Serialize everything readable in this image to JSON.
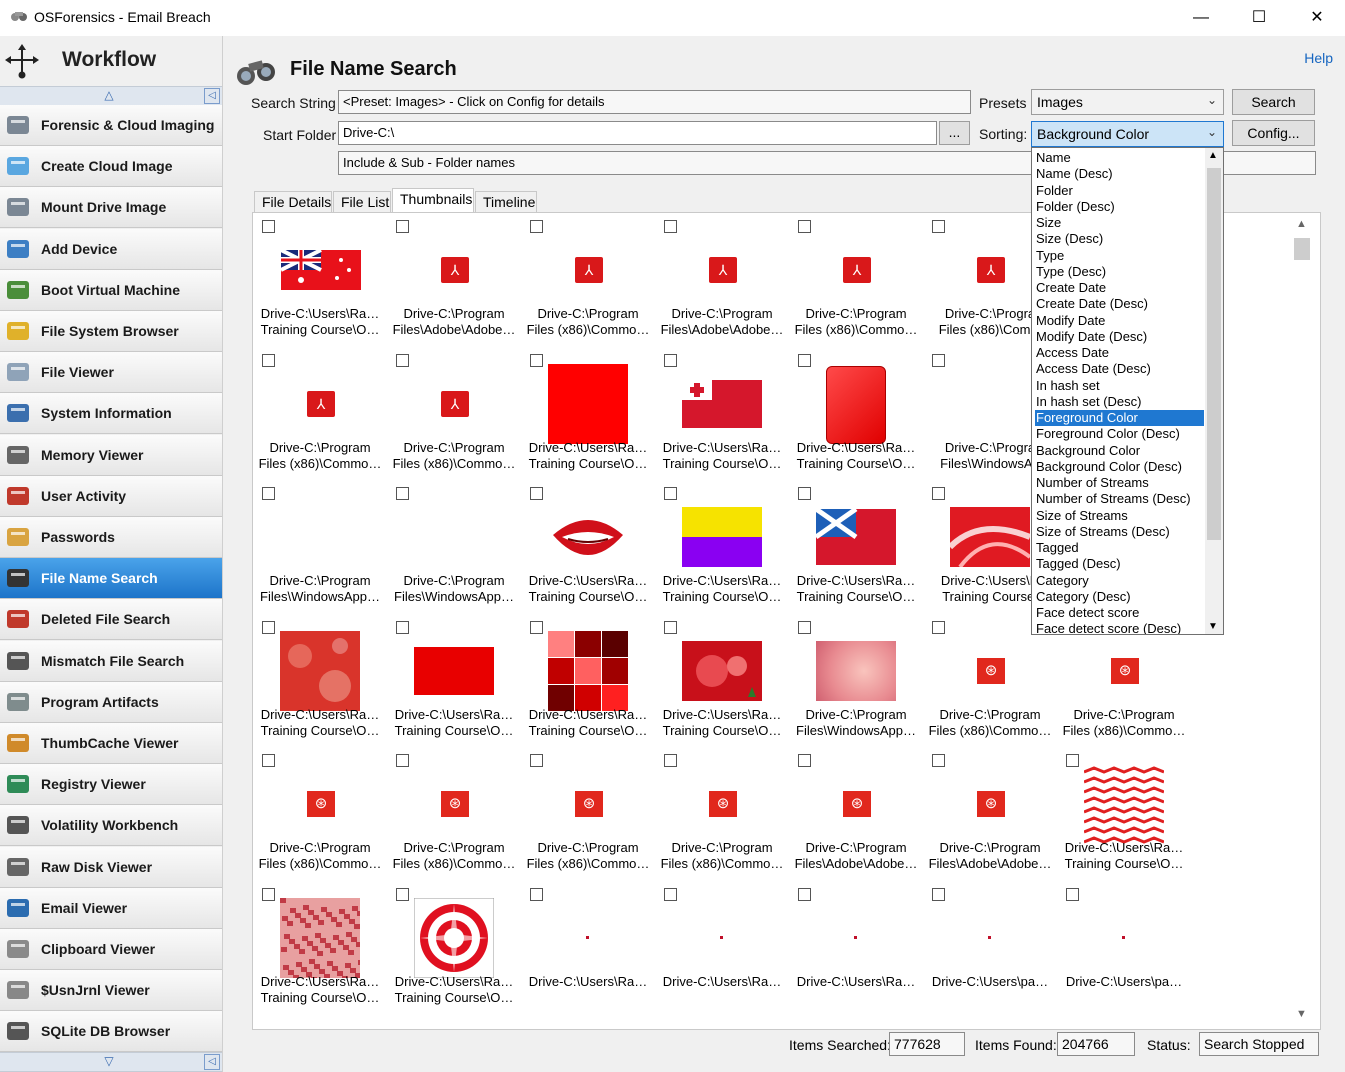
{
  "window": {
    "title": "OSForensics - Email Breach",
    "minimize": "—",
    "maximize": "☐",
    "close": "✕"
  },
  "sidebar": {
    "title": "Workflow",
    "items": [
      {
        "label": "Forensic & Cloud Imaging",
        "icon": "disk-icon"
      },
      {
        "label": "Create Cloud Image",
        "icon": "cloud-icon"
      },
      {
        "label": "Mount Drive Image",
        "icon": "drive-icon"
      },
      {
        "label": "Add Device",
        "icon": "add-device-icon"
      },
      {
        "label": "Boot Virtual Machine",
        "icon": "vm-icon"
      },
      {
        "label": "File System Browser",
        "icon": "folder-icon"
      },
      {
        "label": "File Viewer",
        "icon": "file-viewer-icon"
      },
      {
        "label": "System Information",
        "icon": "system-info-icon"
      },
      {
        "label": "Memory Viewer",
        "icon": "memory-icon"
      },
      {
        "label": "User Activity",
        "icon": "user-activity-icon"
      },
      {
        "label": "Passwords",
        "icon": "passwords-icon"
      },
      {
        "label": "File Name Search",
        "icon": "binoculars-icon"
      },
      {
        "label": "Deleted File Search",
        "icon": "deleted-file-icon"
      },
      {
        "label": "Mismatch File Search",
        "icon": "mismatch-icon"
      },
      {
        "label": "Program Artifacts",
        "icon": "artifacts-icon"
      },
      {
        "label": "ThumbCache Viewer",
        "icon": "thumbcache-icon"
      },
      {
        "label": "Registry Viewer",
        "icon": "registry-icon"
      },
      {
        "label": "Volatility Workbench",
        "icon": "volatility-icon"
      },
      {
        "label": "Raw Disk Viewer",
        "icon": "raw-disk-icon"
      },
      {
        "label": "Email Viewer",
        "icon": "email-icon"
      },
      {
        "label": "Clipboard Viewer",
        "icon": "clipboard-icon"
      },
      {
        "label": "$UsnJrnl Viewer",
        "icon": "usnjrnl-icon"
      },
      {
        "label": "SQLite DB Browser",
        "icon": "sqlite-icon"
      }
    ]
  },
  "header": {
    "title": "File Name Search",
    "help": "Help"
  },
  "form": {
    "search_label": "Search String",
    "search_value": "<Preset: Images> - Click on Config for details",
    "folder_label": "Start Folder",
    "folder_value": "Drive-C:\\",
    "browse_label": "...",
    "scope_value": "Include & Sub - Folder names",
    "presets_label": "Presets",
    "presets_value": "Images",
    "sorting_label": "Sorting:",
    "sorting_value": "Background Color",
    "search_button": "Search",
    "config_button": "Config..."
  },
  "tabs": [
    "File Details",
    "File List",
    "Thumbnails",
    "Timeline"
  ],
  "sort_options": [
    "Name",
    "Name (Desc)",
    "Folder",
    "Folder (Desc)",
    "Size",
    "Size (Desc)",
    "Type",
    "Type (Desc)",
    "Create Date",
    "Create Date (Desc)",
    "Modify Date",
    "Modify Date (Desc)",
    "Access Date",
    "Access Date (Desc)",
    "In hash set",
    "In hash set (Desc)",
    "Foreground Color",
    "Foreground Color (Desc)",
    "Background Color",
    "Background Color (Desc)",
    "Number of Streams",
    "Number of Streams (Desc)",
    "Size of Streams",
    "Size of Streams (Desc)",
    "Tagged",
    "Tagged (Desc)",
    "Category",
    "Category (Desc)",
    "Face detect score",
    "Face detect score (Desc)"
  ],
  "thumbnails": [
    [
      {
        "kind": "flag-au",
        "l1": "Drive-C:\\Users\\Ra…",
        "l2": "Training Course\\O…"
      },
      {
        "kind": "pdf",
        "l1": "Drive-C:\\Program",
        "l2": "Files\\Adobe\\Adobe…"
      },
      {
        "kind": "pdf",
        "l1": "Drive-C:\\Program",
        "l2": "Files (x86)\\Commo…"
      },
      {
        "kind": "pdf",
        "l1": "Drive-C:\\Program",
        "l2": "Files\\Adobe\\Adobe…"
      },
      {
        "kind": "pdf",
        "l1": "Drive-C:\\Program",
        "l2": "Files (x86)\\Commo…"
      },
      {
        "kind": "pdf",
        "l1": "Drive-C:\\Progra",
        "l2": "Files (x86)\\Comm"
      }
    ],
    [
      {
        "kind": "pdf",
        "l1": "Drive-C:\\Program",
        "l2": "Files (x86)\\Commo…"
      },
      {
        "kind": "pdf",
        "l1": "Drive-C:\\Program",
        "l2": "Files (x86)\\Commo…"
      },
      {
        "kind": "red-square",
        "l1": "Drive-C:\\Users\\Ra…",
        "l2": "Training Course\\O…"
      },
      {
        "kind": "flag-tonga",
        "l1": "Drive-C:\\Users\\Ra…",
        "l2": "Training Course\\O…"
      },
      {
        "kind": "red-rounded",
        "l1": "Drive-C:\\Users\\Ra…",
        "l2": "Training Course\\O…"
      },
      {
        "kind": "none",
        "l1": "Drive-C:\\Progra",
        "l2": "Files\\WindowsAp"
      }
    ],
    [
      {
        "kind": "none",
        "l1": "Drive-C:\\Program",
        "l2": "Files\\WindowsApp…"
      },
      {
        "kind": "none",
        "l1": "Drive-C:\\Program",
        "l2": "Files\\WindowsApp…"
      },
      {
        "kind": "lips",
        "l1": "Drive-C:\\Users\\Ra…",
        "l2": "Training Course\\O…"
      },
      {
        "kind": "yellow-purple",
        "l1": "Drive-C:\\Users\\Ra…",
        "l2": "Training Course\\O…"
      },
      {
        "kind": "flag-scot",
        "l1": "Drive-C:\\Users\\Ra…",
        "l2": "Training Course\\O…"
      },
      {
        "kind": "red-abstract",
        "l1": "Drive-C:\\Users\\R",
        "l2": "Training Course\\"
      }
    ],
    [
      {
        "kind": "red-grunge",
        "l1": "Drive-C:\\Users\\Ra…",
        "l2": "Training Course\\O…"
      },
      {
        "kind": "red-rect",
        "l1": "Drive-C:\\Users\\Ra…",
        "l2": "Training Course\\O…"
      },
      {
        "kind": "red-grid",
        "l1": "Drive-C:\\Users\\Ra…",
        "l2": "Training Course\\O…"
      },
      {
        "kind": "red-xmas",
        "l1": "Drive-C:\\Users\\Ra…",
        "l2": "Training Course\\O…"
      },
      {
        "kind": "pink-blur",
        "l1": "Drive-C:\\Program",
        "l2": "Files\\WindowsApp…"
      },
      {
        "kind": "acc",
        "l1": "Drive-C:\\Program",
        "l2": "Files (x86)\\Commo…"
      },
      {
        "kind": "acc",
        "l1": "Drive-C:\\Program",
        "l2": "Files (x86)\\Commo…"
      }
    ],
    [
      {
        "kind": "acc",
        "l1": "Drive-C:\\Program",
        "l2": "Files (x86)\\Commo…"
      },
      {
        "kind": "acc",
        "l1": "Drive-C:\\Program",
        "l2": "Files (x86)\\Commo…"
      },
      {
        "kind": "acc",
        "l1": "Drive-C:\\Program",
        "l2": "Files (x86)\\Commo…"
      },
      {
        "kind": "acc",
        "l1": "Drive-C:\\Program",
        "l2": "Files (x86)\\Commo…"
      },
      {
        "kind": "acc",
        "l1": "Drive-C:\\Program",
        "l2": "Files\\Adobe\\Adobe…"
      },
      {
        "kind": "acc",
        "l1": "Drive-C:\\Program",
        "l2": "Files\\Adobe\\Adobe…"
      },
      {
        "kind": "chevron",
        "l1": "Drive-C:\\Users\\Ra…",
        "l2": "Training Course\\O…"
      }
    ],
    [
      {
        "kind": "red-noise",
        "l1": "Drive-C:\\Users\\Ra…",
        "l2": "Training Course\\O…"
      },
      {
        "kind": "spiral",
        "l1": "Drive-C:\\Users\\Ra…",
        "l2": "Training Course\\O…"
      },
      {
        "kind": "dot",
        "l1": "Drive-C:\\Users\\Ra…",
        "l2": ""
      },
      {
        "kind": "dot",
        "l1": "Drive-C:\\Users\\Ra…",
        "l2": ""
      },
      {
        "kind": "dot",
        "l1": "Drive-C:\\Users\\Ra…",
        "l2": ""
      },
      {
        "kind": "dot",
        "l1": "Drive-C:\\Users\\pa…",
        "l2": ""
      },
      {
        "kind": "dot",
        "l1": "Drive-C:\\Users\\pa…",
        "l2": ""
      }
    ]
  ],
  "status": {
    "searched_label": "Items Searched:",
    "searched_value": "777628",
    "found_label": "Items Found:",
    "found_value": "204766",
    "status_label": "Status:",
    "status_value": "Search Stopped"
  },
  "colors": {
    "accent": "#1f78d1",
    "active_nav": "#1d74c9",
    "thumb_red": "#e30613"
  }
}
